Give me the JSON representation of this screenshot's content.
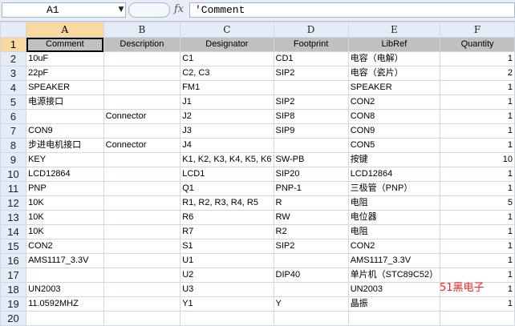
{
  "namebox": "A1",
  "formula": "'Comment",
  "fx_label": "fx",
  "columns": [
    "A",
    "B",
    "C",
    "D",
    "E",
    "F"
  ],
  "rows": [
    {
      "n": "1",
      "cells": [
        "Comment",
        "Description",
        "Designator",
        "Footprint",
        "LibRef",
        "Quantity"
      ]
    },
    {
      "n": "2",
      "cells": [
        "10uF",
        "",
        "C1",
        "CD1",
        "电容（电解）",
        "1"
      ]
    },
    {
      "n": "3",
      "cells": [
        "22pF",
        "",
        "C2, C3",
        "SIP2",
        "电容（瓷片）",
        "2"
      ]
    },
    {
      "n": "4",
      "cells": [
        "SPEAKER",
        "",
        "FM1",
        "",
        "SPEAKER",
        "1"
      ]
    },
    {
      "n": "5",
      "cells": [
        "电源接口",
        "",
        "J1",
        "SIP2",
        "CON2",
        "1"
      ]
    },
    {
      "n": "6",
      "cells": [
        "",
        "Connector",
        "J2",
        "SIP8",
        "CON8",
        "1"
      ]
    },
    {
      "n": "7",
      "cells": [
        "CON9",
        "",
        "J3",
        "SIP9",
        "CON9",
        "1"
      ]
    },
    {
      "n": "8",
      "cells": [
        "步进电机接口",
        "Connector",
        "J4",
        "",
        "CON5",
        "1"
      ]
    },
    {
      "n": "9",
      "cells": [
        "KEY",
        "",
        "K1, K2, K3, K4, K5, K6",
        "SW-PB",
        "按键",
        "10"
      ]
    },
    {
      "n": "10",
      "cells": [
        "LCD12864",
        "",
        "LCD1",
        "SIP20",
        "LCD12864",
        "1"
      ]
    },
    {
      "n": "11",
      "cells": [
        "PNP",
        "",
        "Q1",
        "PNP-1",
        "三极管（PNP）",
        "1"
      ]
    },
    {
      "n": "12",
      "cells": [
        "10K",
        "",
        "R1, R2, R3, R4, R5",
        "R",
        "电阻",
        "5"
      ]
    },
    {
      "n": "13",
      "cells": [
        "10K",
        "",
        "R6",
        "RW",
        "电位器",
        "1"
      ]
    },
    {
      "n": "14",
      "cells": [
        "10K",
        "",
        "R7",
        "R2",
        "电阻",
        "1"
      ]
    },
    {
      "n": "15",
      "cells": [
        "CON2",
        "",
        "S1",
        "SIP2",
        "CON2",
        "1"
      ]
    },
    {
      "n": "16",
      "cells": [
        "AMS1117_3.3V",
        "",
        "U1",
        "",
        "AMS1117_3.3V",
        "1"
      ]
    },
    {
      "n": "17",
      "cells": [
        "",
        "",
        "U2",
        "DIP40",
        "单片机（STC89C52）",
        "1"
      ]
    },
    {
      "n": "18",
      "cells": [
        "UN2003",
        "",
        "U3",
        "",
        "UN2003",
        "1"
      ]
    },
    {
      "n": "19",
      "cells": [
        "11.0592MHZ",
        "",
        "Y1",
        "Y",
        "晶振",
        "1"
      ]
    },
    {
      "n": "20",
      "cells": [
        "",
        "",
        "",
        "",
        "",
        ""
      ]
    }
  ],
  "watermark": "51黑电子"
}
